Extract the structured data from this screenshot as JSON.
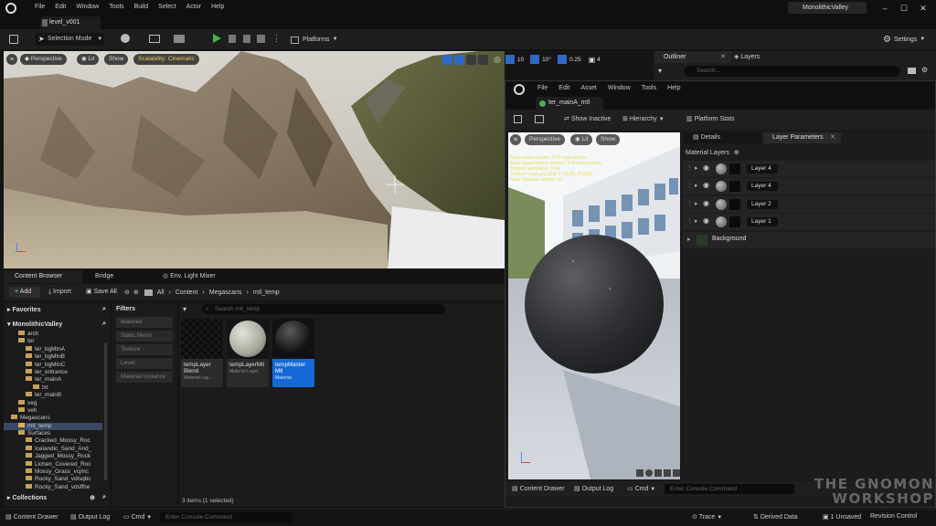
{
  "menu": [
    "File",
    "Edit",
    "Window",
    "Tools",
    "Build",
    "Select",
    "Actor",
    "Help"
  ],
  "project_name": "MonolithicValley",
  "level_tab": "level_v001",
  "toolbar": {
    "selection_mode": "Selection Mode",
    "platforms": "Platforms",
    "settings": "Settings"
  },
  "viewport": {
    "perspective": "Perspective",
    "lit": "Lit",
    "show": "Show",
    "scalability": "Scalability: Cinematic",
    "grid": "10",
    "angle": "10°",
    "scale": "0.25",
    "cam": "4"
  },
  "outliner": {
    "tab": "Outliner",
    "layers_tab": "Layers",
    "search_placeholder": "Search..."
  },
  "content_browser": {
    "tabs": [
      "Content Browser",
      "Bridge",
      "Env. Light Mixer"
    ],
    "add": "Add",
    "import": "Import",
    "save_all": "Save All",
    "breadcrumb": [
      "All",
      "Content",
      "Megascans",
      "mtl_temp"
    ],
    "favorites": "Favorites",
    "root": "MonolithicValley",
    "tree": [
      {
        "label": "arch",
        "indent": 1
      },
      {
        "label": "ter",
        "indent": 1
      },
      {
        "label": "ter_bgMtnA",
        "indent": 2
      },
      {
        "label": "ter_bgMtnB",
        "indent": 2
      },
      {
        "label": "ter_bgMtnC",
        "indent": 2
      },
      {
        "label": "ter_entrance",
        "indent": 2
      },
      {
        "label": "ter_mainA",
        "indent": 2
      },
      {
        "label": "txt",
        "indent": 3
      },
      {
        "label": "ter_mainB",
        "indent": 2
      },
      {
        "label": "veg",
        "indent": 1
      },
      {
        "label": "veh",
        "indent": 1
      },
      {
        "label": "Megascans",
        "indent": 0
      },
      {
        "label": "mtl_temp",
        "indent": 1,
        "selected": true
      },
      {
        "label": "Surfaces",
        "indent": 1
      },
      {
        "label": "Cracked_Mossy_Roc",
        "indent": 2
      },
      {
        "label": "Icelandic_Sand_And_",
        "indent": 2
      },
      {
        "label": "Jagged_Mossy_Rock",
        "indent": 2
      },
      {
        "label": "Lichen_Covered_Roc",
        "indent": 2
      },
      {
        "label": "Mossy_Grass_vcjmc",
        "indent": 2
      },
      {
        "label": "Rocky_Sand_vdlsqbc",
        "indent": 2
      },
      {
        "label": "Rocky_Sand_vdsffhe",
        "indent": 2
      }
    ],
    "collections": "Collections",
    "filters_title": "Filters",
    "filters": [
      "Material",
      "Static Mesh",
      "Texture",
      "Level",
      "Material Instance"
    ],
    "search_placeholder": "Search mtl_temp",
    "assets": [
      {
        "name": "tempLayer Blend",
        "type": "Material Lay..."
      },
      {
        "name": "tempLayerMtl",
        "type": "Material Layer"
      },
      {
        "name": "tempMaster Mtl",
        "type": "Material"
      }
    ],
    "status": "3 items (1 selected)"
  },
  "material_editor": {
    "menu": [
      "File",
      "Edit",
      "Asset",
      "Window",
      "Tools",
      "Help"
    ],
    "tab": "ter_mainA_mtl",
    "show_inactive": "Show Inactive",
    "hierarchy": "Hierarchy",
    "platform_stats": "Platform Stats",
    "viewport": {
      "perspective": "Perspective",
      "lit": "Lit",
      "show": "Show"
    },
    "stats": [
      "Base pass shader: 579 instructions",
      "Base pass vertex shader: 249 instructions",
      "Texture samplers: 7/16",
      "Texture Lookups (Est.): VS(3), PS(35)",
      "Num shaders added: 32"
    ],
    "details_tab": "Details",
    "layer_params_tab": "Layer Parameters",
    "material_layers": "Material Layers",
    "layers": [
      "Layer 4",
      "Layer 4",
      "Layer 2",
      "Layer 1"
    ],
    "background": "Background",
    "content_drawer": "Content Drawer",
    "output_log": "Output Log",
    "cmd": "Cmd",
    "console_placeholder": "Enter Console Command"
  },
  "bottom_bar": {
    "content_drawer": "Content Drawer",
    "output_log": "Output Log",
    "cmd": "Cmd",
    "console_placeholder": "Enter Console Command",
    "trace": "Trace",
    "derived_data": "Derived Data",
    "unsaved": "1 Unsaved",
    "revision_control": "Revision Control"
  },
  "watermark": "THE GNOMON WORKSHOP"
}
